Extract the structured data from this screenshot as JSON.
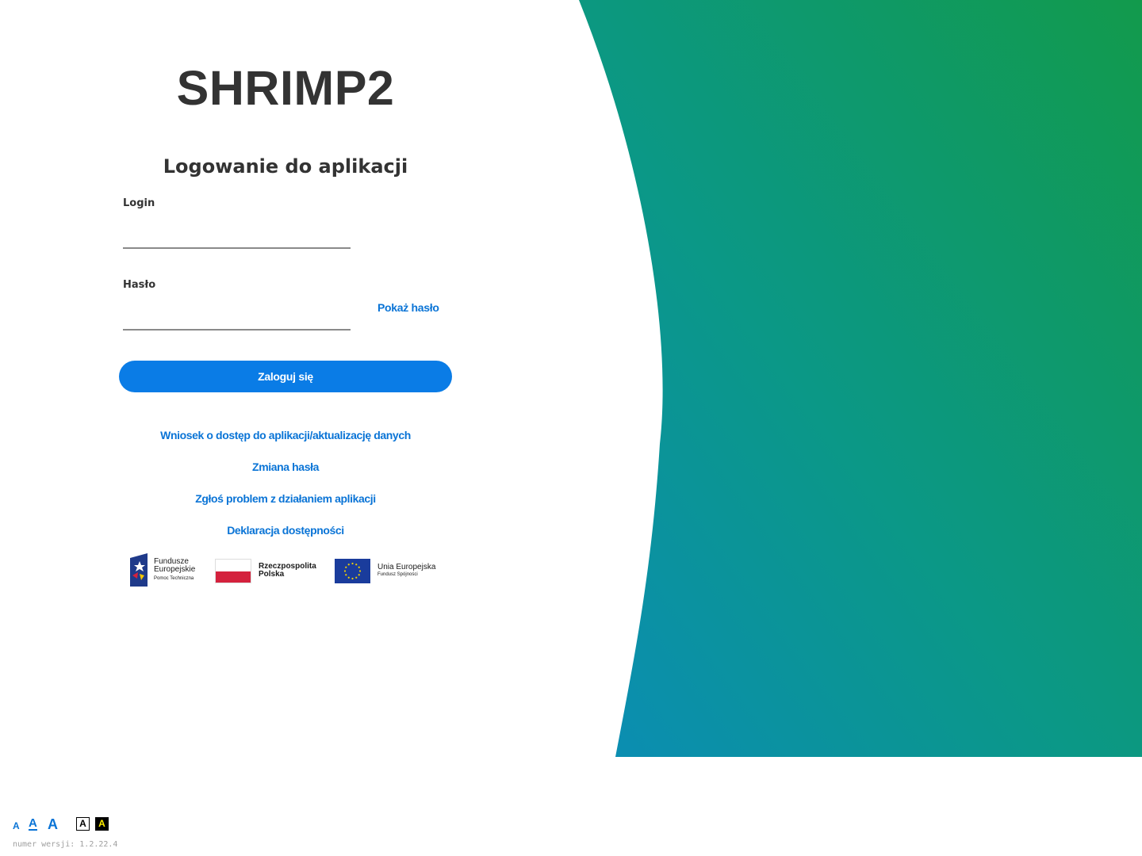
{
  "app": {
    "title": "SHRIMP2"
  },
  "login_form": {
    "heading": "Logowanie do aplikacji",
    "login_label": "Login",
    "login_value": "",
    "password_label": "Hasło",
    "password_value": "",
    "show_password": "Pokaż hasło",
    "submit_label": "Zaloguj się"
  },
  "links": {
    "access_request": "Wniosek o dostęp do aplikacji/aktualizację danych",
    "change_password": "Zmiana hasła",
    "report_problem": "Zgłoś problem z działaniem aplikacji",
    "accessibility_statement": "Deklaracja dostępności"
  },
  "logos": {
    "fe": {
      "line1": "Fundusze",
      "line2": "Europejskie",
      "line3": "Pomoc Techniczna"
    },
    "rp": {
      "line1": "Rzeczpospolita",
      "line2": "Polska"
    },
    "ue": {
      "line1": "Unia Europejska",
      "line2": "Fundusz Spójności"
    }
  },
  "accessibility": {
    "font_small": "A",
    "font_medium": "A",
    "font_large": "A",
    "contrast_normal": "A",
    "contrast_high": "A"
  },
  "footer": {
    "version": "numer wersji: 1.2.22.4"
  },
  "colors": {
    "accent": "#0a7ce6",
    "link": "#0a74d6",
    "gradient_top": "#129a4c",
    "gradient_bottom": "#0b8db5"
  },
  "icons": {
    "fe_logo": "fundusze-europejskie-logo",
    "rp_flag": "polish-flag-icon",
    "ue_flag": "eu-flag-icon"
  }
}
